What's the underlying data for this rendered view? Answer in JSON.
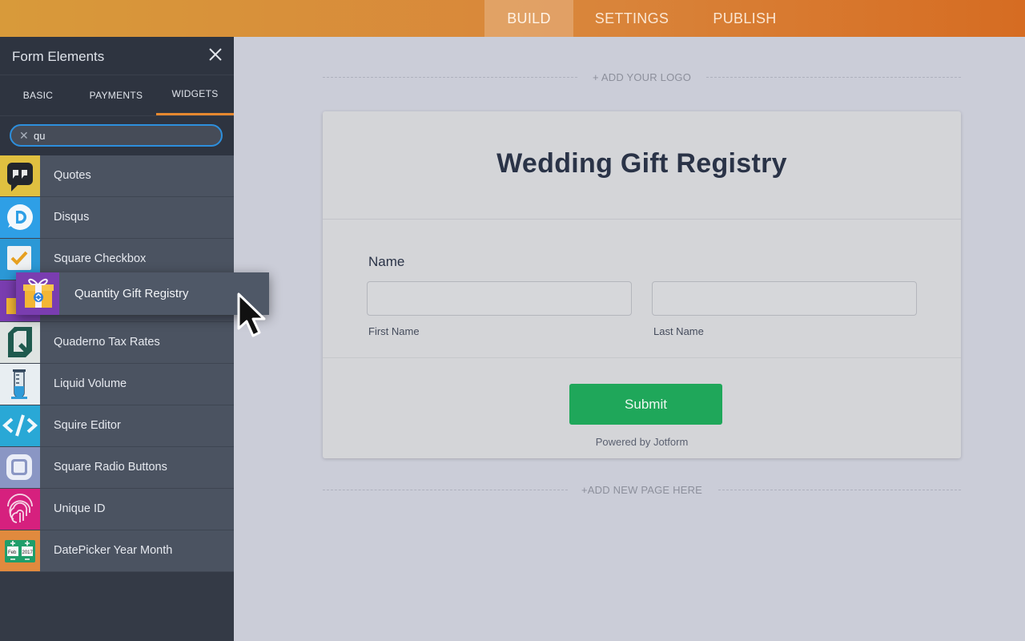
{
  "topbar": {
    "tabs": [
      {
        "label": "BUILD",
        "active": true
      },
      {
        "label": "SETTINGS",
        "active": false
      },
      {
        "label": "PUBLISH",
        "active": false
      }
    ],
    "accent_color": "#d9843a"
  },
  "sidebar": {
    "title": "Form Elements",
    "tabs": [
      {
        "label": "BASIC"
      },
      {
        "label": "PAYMENTS"
      },
      {
        "label": "WIDGETS",
        "active": true
      }
    ],
    "search": {
      "value": "qu"
    },
    "items": [
      {
        "label": "Quotes",
        "icon": "quotes-icon",
        "color": "#e0c040"
      },
      {
        "label": "Disqus",
        "icon": "disqus-icon",
        "color": "#2e9fe6"
      },
      {
        "label": "Square Checkbox",
        "icon": "checkbox-icon",
        "color": "#2b98d6"
      },
      {
        "label": "Quantity Gift Registry",
        "icon": "gift-icon",
        "color": "#7a3db0"
      },
      {
        "label": "Quaderno Tax Rates",
        "icon": "quaderno-icon",
        "color": "#dfe4e2"
      },
      {
        "label": "Liquid Volume",
        "icon": "beaker-icon",
        "color": "#e8eef2"
      },
      {
        "label": "Squire Editor",
        "icon": "code-icon",
        "color": "#29a8d6"
      },
      {
        "label": "Square Radio Buttons",
        "icon": "radio-icon",
        "color": "#8a96c4"
      },
      {
        "label": "Unique ID",
        "icon": "fingerprint-icon",
        "color": "#d6207e"
      },
      {
        "label": "DatePicker Year Month",
        "icon": "datepicker-icon",
        "color": "#e08a3e"
      }
    ]
  },
  "dragging": {
    "label": "Quantity Gift Registry",
    "icon": "gift-icon"
  },
  "canvas": {
    "add_logo": "+ ADD YOUR LOGO",
    "form_title": "Wedding Gift Registry",
    "name_label": "Name",
    "first_name": "First Name",
    "last_name": "Last Name",
    "submit": "Submit",
    "powered_by": "Powered by Jotform",
    "add_page": "+ADD NEW PAGE HERE"
  }
}
